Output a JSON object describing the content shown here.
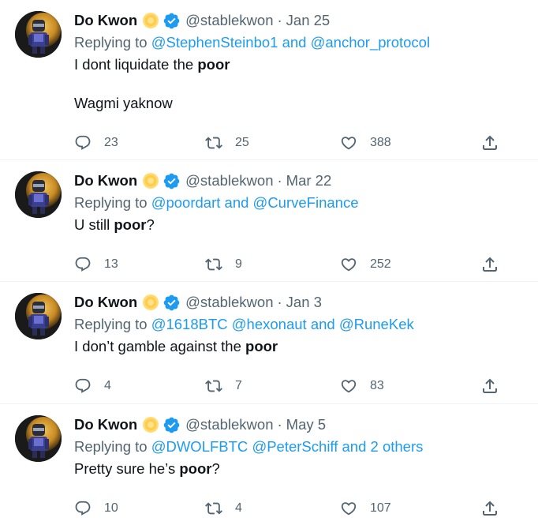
{
  "tweets": [
    {
      "name": "Do Kwon",
      "handle": "@stablekwon",
      "separator": "·",
      "date": "Jan 25",
      "replying_prefix": "Replying to",
      "mentions": [
        "@StephenSteinbo1",
        "@anchor_protocol"
      ],
      "mention_joiner": "and",
      "mention_suffix": "",
      "lines": [
        {
          "before": "I dont liquidate the ",
          "bold": "poor",
          "after": ""
        },
        {
          "blank": true
        },
        {
          "before": "Wagmi yaknow",
          "bold": "",
          "after": ""
        }
      ],
      "replies": "23",
      "retweets": "25",
      "likes": "388"
    },
    {
      "name": "Do Kwon",
      "handle": "@stablekwon",
      "separator": "·",
      "date": "Mar 22",
      "replying_prefix": "Replying to",
      "mentions": [
        "@poordart",
        "@CurveFinance"
      ],
      "mention_joiner": "and",
      "mention_suffix": "",
      "lines": [
        {
          "before": "U still ",
          "bold": "poor",
          "after": "?"
        }
      ],
      "replies": "13",
      "retweets": "9",
      "likes": "252"
    },
    {
      "name": "Do Kwon",
      "handle": "@stablekwon",
      "separator": "·",
      "date": "Jan 3",
      "replying_prefix": "Replying to",
      "mentions": [
        "@1618BTC",
        "@hexonaut",
        "@RuneKek"
      ],
      "mention_joiner": "and",
      "mention_suffix": "",
      "lines": [
        {
          "before": "I don’t gamble against the ",
          "bold": "poor",
          "after": ""
        }
      ],
      "replies": "4",
      "retweets": "7",
      "likes": "83"
    },
    {
      "name": "Do Kwon",
      "handle": "@stablekwon",
      "separator": "·",
      "date": "May 5",
      "replying_prefix": "Replying to",
      "mentions": [
        "@DWOLFBTC",
        "@PeterSchiff"
      ],
      "mention_joiner": "",
      "mention_suffix": "and 2 others",
      "lines": [
        {
          "before": "Pretty sure he’s ",
          "bold": "poor",
          "after": "?"
        }
      ],
      "replies": "10",
      "retweets": "4",
      "likes": "107"
    }
  ],
  "colors": {
    "text": "#0f1419",
    "muted": "#536471",
    "link": "#1d9bf0",
    "verified": "#1d9bf0",
    "sun": "#ffcc4d"
  },
  "icons": {
    "reply": "reply-icon",
    "retweet": "retweet-icon",
    "like": "heart-icon",
    "share": "share-icon",
    "verified": "verified-badge-icon",
    "emoji": "sun-emoji"
  }
}
